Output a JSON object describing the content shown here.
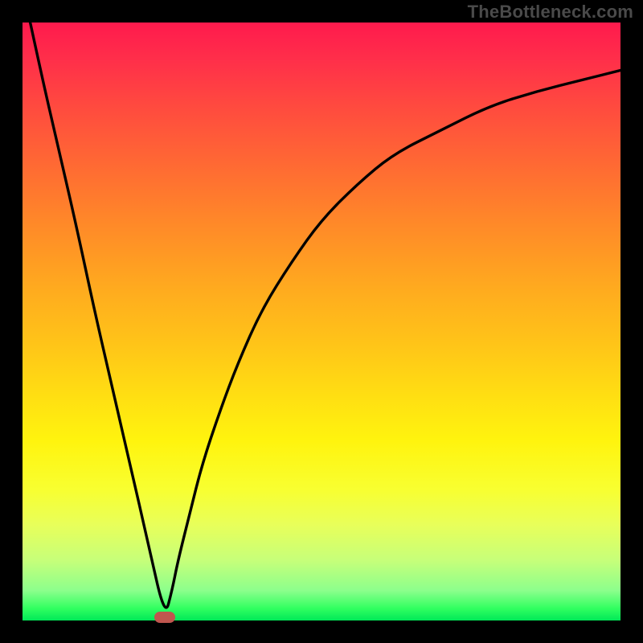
{
  "watermark": "TheBottleneck.com",
  "chart_data": {
    "type": "line",
    "title": "",
    "xlabel": "",
    "ylabel": "",
    "xlim": [
      0,
      100
    ],
    "ylim": [
      0,
      100
    ],
    "grid": false,
    "series": [
      {
        "name": "curve",
        "x": [
          0,
          3,
          6,
          9,
          12,
          15,
          18,
          21,
          23.8,
          25,
          26,
          28,
          30,
          33,
          36,
          40,
          45,
          50,
          56,
          62,
          70,
          78,
          86,
          94,
          100
        ],
        "y": [
          106,
          92,
          79,
          66,
          52,
          39,
          26,
          13,
          0.5,
          5,
          10,
          18,
          26,
          35,
          43,
          52,
          60,
          67,
          73,
          78,
          82,
          86,
          88.5,
          90.5,
          92
        ]
      }
    ],
    "marker": {
      "x": 23.8,
      "y": 0.5
    },
    "colors": {
      "curve": "#000000",
      "marker": "#c0564e",
      "gradient_top": "#ff1a4d",
      "gradient_bottom": "#00e858"
    }
  }
}
